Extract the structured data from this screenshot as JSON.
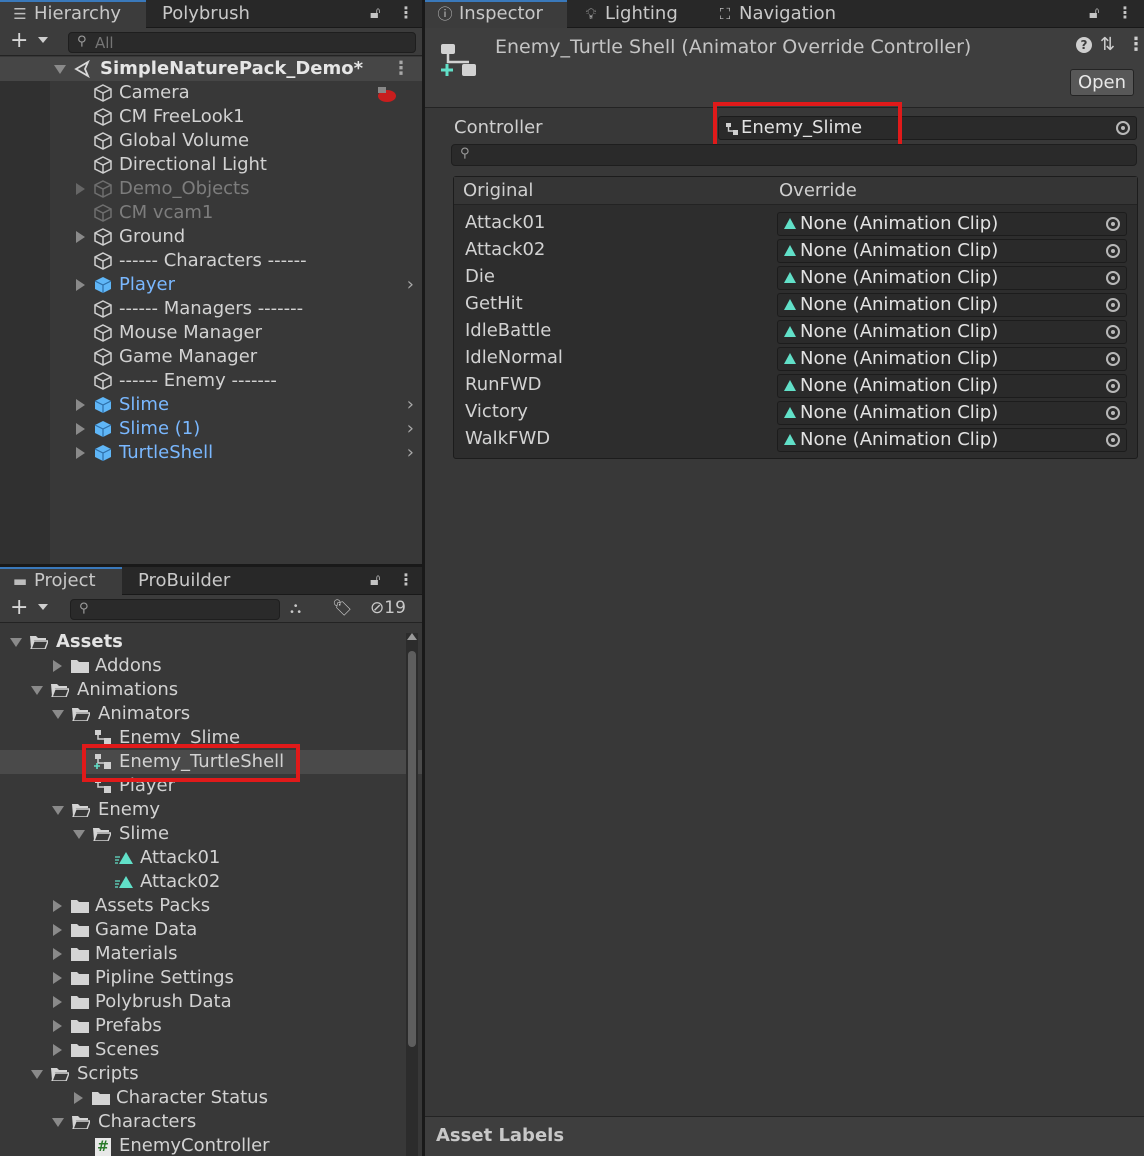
{
  "hierarchy": {
    "tabs": [
      "Hierarchy",
      "Polybrush"
    ],
    "search_placeholder": "All",
    "scene_name": "SimpleNaturePack_Demo*",
    "items": [
      {
        "label": "Camera",
        "type": "normal"
      },
      {
        "label": "CM FreeLook1",
        "type": "normal"
      },
      {
        "label": "Global Volume",
        "type": "normal"
      },
      {
        "label": "Directional Light",
        "type": "normal"
      },
      {
        "label": "Demo_Objects",
        "type": "disabled"
      },
      {
        "label": "CM vcam1",
        "type": "disabled"
      },
      {
        "label": "Ground",
        "type": "normal"
      },
      {
        "label": "------ Characters ------",
        "type": "normal"
      },
      {
        "label": "Player",
        "type": "prefab"
      },
      {
        "label": "------ Managers -------",
        "type": "normal"
      },
      {
        "label": "Mouse Manager",
        "type": "normal"
      },
      {
        "label": "Game Manager",
        "type": "normal"
      },
      {
        "label": "------ Enemy -------",
        "type": "normal"
      },
      {
        "label": "Slime",
        "type": "prefab"
      },
      {
        "label": "Slime (1)",
        "type": "prefab"
      },
      {
        "label": "TurtleShell",
        "type": "prefab"
      }
    ]
  },
  "project": {
    "tabs": [
      "Project",
      "ProBuilder"
    ],
    "hidden_count": "19",
    "tree": [
      {
        "label": "Assets",
        "depth": 0,
        "kind": "folder-open",
        "bold": true
      },
      {
        "label": "Addons",
        "depth": 1,
        "kind": "folder"
      },
      {
        "label": "Animations",
        "depth": 1,
        "kind": "folder-open"
      },
      {
        "label": "Animators",
        "depth": 2,
        "kind": "folder-open"
      },
      {
        "label": "Enemy_Slime",
        "depth": 3,
        "kind": "controller"
      },
      {
        "label": "Enemy_TurtleShell",
        "depth": 3,
        "kind": "override",
        "selected": true
      },
      {
        "label": "Player",
        "depth": 3,
        "kind": "controller"
      },
      {
        "label": "Enemy",
        "depth": 2,
        "kind": "folder-open"
      },
      {
        "label": "Slime",
        "depth": 3,
        "kind": "folder-open"
      },
      {
        "label": "Attack01",
        "depth": 4,
        "kind": "clip"
      },
      {
        "label": "Attack02",
        "depth": 4,
        "kind": "clip"
      },
      {
        "label": "Assets Packs",
        "depth": 1,
        "kind": "folder"
      },
      {
        "label": "Game Data",
        "depth": 1,
        "kind": "folder"
      },
      {
        "label": "Materials",
        "depth": 1,
        "kind": "folder"
      },
      {
        "label": "Pipline Settings",
        "depth": 1,
        "kind": "folder"
      },
      {
        "label": "Polybrush Data",
        "depth": 1,
        "kind": "folder"
      },
      {
        "label": "Prefabs",
        "depth": 1,
        "kind": "folder"
      },
      {
        "label": "Scenes",
        "depth": 1,
        "kind": "folder"
      },
      {
        "label": "Scripts",
        "depth": 1,
        "kind": "folder-open"
      },
      {
        "label": "Character Status",
        "depth": 2,
        "kind": "folder"
      },
      {
        "label": "Characters",
        "depth": 2,
        "kind": "folder-open"
      },
      {
        "label": "EnemyController",
        "depth": 3,
        "kind": "script"
      }
    ]
  },
  "inspector": {
    "tabs": [
      "Inspector",
      "Lighting",
      "Navigation"
    ],
    "title": "Enemy_Turtle Shell (Animator Override Controller)",
    "open_label": "Open",
    "controller_label": "Controller",
    "controller_value": "Enemy_Slime",
    "col_original": "Original",
    "col_override": "Override",
    "clips": [
      {
        "original": "Attack01",
        "override": "None (Animation Clip)"
      },
      {
        "original": "Attack02",
        "override": "None (Animation Clip)"
      },
      {
        "original": "Die",
        "override": "None (Animation Clip)"
      },
      {
        "original": "GetHit",
        "override": "None (Animation Clip)"
      },
      {
        "original": "IdleBattle",
        "override": "None (Animation Clip)"
      },
      {
        "original": "IdleNormal",
        "override": "None (Animation Clip)"
      },
      {
        "original": "RunFWD",
        "override": "None (Animation Clip)"
      },
      {
        "original": "Victory",
        "override": "None (Animation Clip)"
      },
      {
        "original": "WalkFWD",
        "override": "None (Animation Clip)"
      }
    ],
    "asset_labels": "Asset Labels"
  },
  "colors": {
    "accent": "#3a79bb",
    "prefab": "#7ab8ff",
    "highlight": "#e01a1a",
    "clip": "#61e0c8"
  },
  "icons": {
    "help": "help-icon",
    "settings": "preset-icon",
    "more": "kebab-menu-icon",
    "lock": "lock-icon"
  }
}
